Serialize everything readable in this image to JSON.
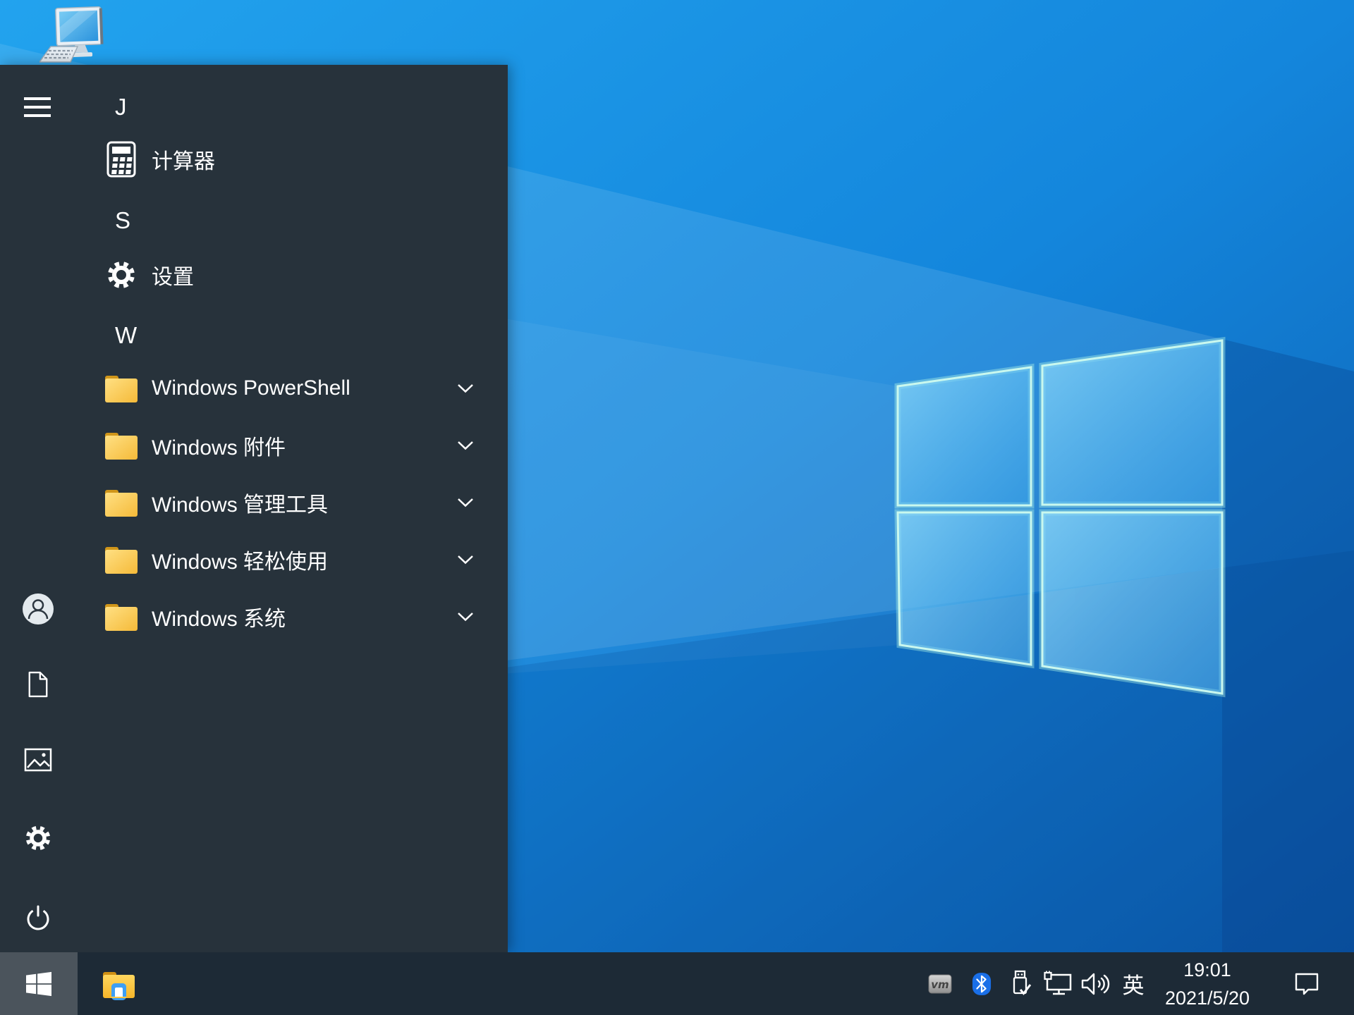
{
  "colors": {
    "menu_bg": "#27323b",
    "taskbar_bg": "#1d2a36",
    "start_button_active_bg": "#4b545c",
    "wallpaper_top": "#22a3ee",
    "wallpaper_bottom": "#0b58aa",
    "folder_yellow": "#f9c83f",
    "folder_tab": "#d0961a",
    "bluetooth_blue": "#1a6fe8",
    "explorer_blue": "#3d9ff5"
  },
  "desktop": {
    "this_pc_icon": "this-pc-computer-icon"
  },
  "start_menu": {
    "sections": [
      {
        "header": "J"
      },
      {
        "header": "S"
      },
      {
        "header": "W"
      }
    ],
    "items": {
      "calculator": {
        "label": "计算器",
        "icon": "calculator-icon"
      },
      "settings": {
        "label": "设置",
        "icon": "gear-icon"
      }
    },
    "folders": [
      {
        "label": "Windows PowerShell"
      },
      {
        "label": "Windows 附件"
      },
      {
        "label": "Windows 管理工具"
      },
      {
        "label": "Windows 轻松使用"
      },
      {
        "label": "Windows 系统"
      }
    ],
    "rail_icons": [
      "hamburger-icon",
      "user-avatar-icon",
      "document-icon",
      "pictures-icon",
      "gear-icon",
      "power-icon"
    ]
  },
  "taskbar": {
    "start_icon": "windows-logo-icon",
    "pinned_icons": [
      "file-explorer-icon"
    ],
    "tray": {
      "icons": [
        "vmware-icon",
        "bluetooth-icon",
        "usb-safely-remove-icon",
        "network-icon",
        "volume-icon"
      ],
      "ime_label": "英",
      "time": "19:01",
      "date": "2021/5/20",
      "notification_icon": "action-center-icon"
    }
  }
}
